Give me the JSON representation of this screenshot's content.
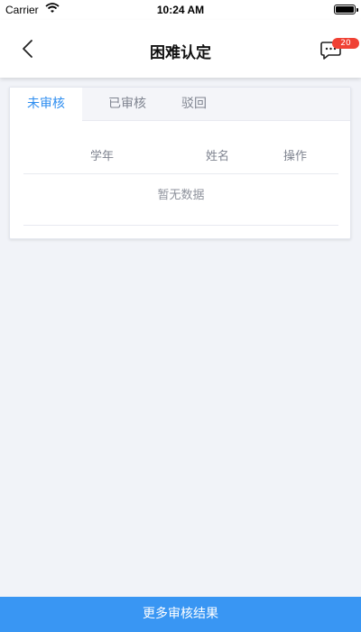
{
  "status_bar": {
    "carrier": "Carrier",
    "time": "10:24 AM"
  },
  "nav": {
    "title": "困难认定",
    "message_badge": "20"
  },
  "tabs": [
    {
      "label": "未审核",
      "active": true
    },
    {
      "label": "已审核",
      "active": false
    },
    {
      "label": "驳回",
      "active": false
    }
  ],
  "table": {
    "columns": [
      "学年",
      "姓名",
      "操作"
    ],
    "empty_text": "暂无数据"
  },
  "footer": {
    "button_label": "更多审核结果"
  },
  "colors": {
    "accent": "#2e8ef0",
    "button": "#3996f3",
    "badge": "#f04134",
    "background": "#f1f3f8"
  }
}
